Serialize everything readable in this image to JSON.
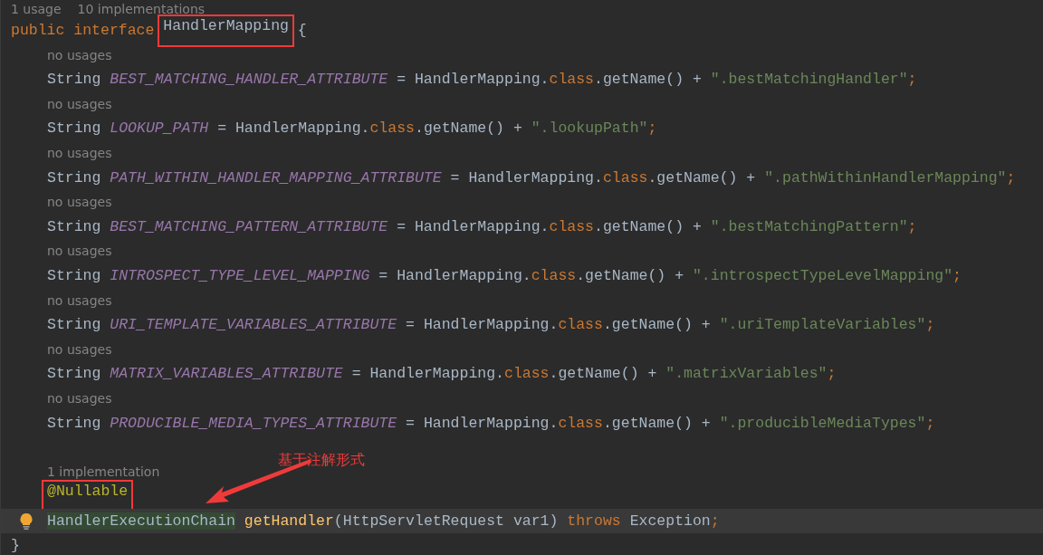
{
  "usage_hints": [
    "1 usage",
    "10 implementations"
  ],
  "declaration": [
    {
      "kind": "keyword",
      "text": "public interface ",
      "boxed": false
    },
    {
      "kind": "plain",
      "text": "HandlerMapping",
      "boxed": true
    },
    {
      "kind": "plain",
      "text": " {",
      "boxed": false
    }
  ],
  "fields": [
    {
      "hint": "no usages",
      "tokens": [
        {
          "kind": "plain",
          "text": "String "
        },
        {
          "kind": "constant",
          "text": "BEST_MATCHING_HANDLER_ATTRIBUTE"
        },
        {
          "kind": "plain",
          "text": " = HandlerMapping."
        },
        {
          "kind": "keyword",
          "text": "class"
        },
        {
          "kind": "plain",
          "text": ".getName() + "
        },
        {
          "kind": "string",
          "text": "\".bestMatchingHandler\""
        },
        {
          "kind": "keyword",
          "text": ";"
        }
      ]
    },
    {
      "hint": "no usages",
      "tokens": [
        {
          "kind": "plain",
          "text": "String "
        },
        {
          "kind": "constant",
          "text": "LOOKUP_PATH"
        },
        {
          "kind": "plain",
          "text": " = HandlerMapping."
        },
        {
          "kind": "keyword",
          "text": "class"
        },
        {
          "kind": "plain",
          "text": ".getName() + "
        },
        {
          "kind": "string",
          "text": "\".lookupPath\""
        },
        {
          "kind": "keyword",
          "text": ";"
        }
      ]
    },
    {
      "hint": "no usages",
      "tokens": [
        {
          "kind": "plain",
          "text": "String "
        },
        {
          "kind": "constant",
          "text": "PATH_WITHIN_HANDLER_MAPPING_ATTRIBUTE"
        },
        {
          "kind": "plain",
          "text": " = HandlerMapping."
        },
        {
          "kind": "keyword",
          "text": "class"
        },
        {
          "kind": "plain",
          "text": ".getName() + "
        },
        {
          "kind": "string",
          "text": "\".pathWithinHandlerMapping\""
        },
        {
          "kind": "keyword",
          "text": ";"
        }
      ]
    },
    {
      "hint": "no usages",
      "tokens": [
        {
          "kind": "plain",
          "text": "String "
        },
        {
          "kind": "constant",
          "text": "BEST_MATCHING_PATTERN_ATTRIBUTE"
        },
        {
          "kind": "plain",
          "text": " = HandlerMapping."
        },
        {
          "kind": "keyword",
          "text": "class"
        },
        {
          "kind": "plain",
          "text": ".getName() + "
        },
        {
          "kind": "string",
          "text": "\".bestMatchingPattern\""
        },
        {
          "kind": "keyword",
          "text": ";"
        }
      ]
    },
    {
      "hint": "no usages",
      "tokens": [
        {
          "kind": "plain",
          "text": "String "
        },
        {
          "kind": "constant",
          "text": "INTROSPECT_TYPE_LEVEL_MAPPING"
        },
        {
          "kind": "plain",
          "text": " = HandlerMapping."
        },
        {
          "kind": "keyword",
          "text": "class"
        },
        {
          "kind": "plain",
          "text": ".getName() + "
        },
        {
          "kind": "string",
          "text": "\".introspectTypeLevelMapping\""
        },
        {
          "kind": "keyword",
          "text": ";"
        }
      ]
    },
    {
      "hint": "no usages",
      "tokens": [
        {
          "kind": "plain",
          "text": "String "
        },
        {
          "kind": "constant",
          "text": "URI_TEMPLATE_VARIABLES_ATTRIBUTE"
        },
        {
          "kind": "plain",
          "text": " = HandlerMapping."
        },
        {
          "kind": "keyword",
          "text": "class"
        },
        {
          "kind": "plain",
          "text": ".getName() + "
        },
        {
          "kind": "string",
          "text": "\".uriTemplateVariables\""
        },
        {
          "kind": "keyword",
          "text": ";"
        }
      ]
    },
    {
      "hint": "no usages",
      "tokens": [
        {
          "kind": "plain",
          "text": "String "
        },
        {
          "kind": "constant",
          "text": "MATRIX_VARIABLES_ATTRIBUTE"
        },
        {
          "kind": "plain",
          "text": " = HandlerMapping."
        },
        {
          "kind": "keyword",
          "text": "class"
        },
        {
          "kind": "plain",
          "text": ".getName() + "
        },
        {
          "kind": "string",
          "text": "\".matrixVariables\""
        },
        {
          "kind": "keyword",
          "text": ";"
        }
      ]
    },
    {
      "hint": "no usages",
      "tokens": [
        {
          "kind": "plain",
          "text": "String "
        },
        {
          "kind": "constant",
          "text": "PRODUCIBLE_MEDIA_TYPES_ATTRIBUTE"
        },
        {
          "kind": "plain",
          "text": " = HandlerMapping."
        },
        {
          "kind": "keyword",
          "text": "class"
        },
        {
          "kind": "plain",
          "text": ".getName() + "
        },
        {
          "kind": "string",
          "text": "\".producibleMediaTypes\""
        },
        {
          "kind": "keyword",
          "text": ";"
        }
      ]
    }
  ],
  "method": {
    "hint": "1 implementation",
    "annotation": {
      "text": "@Nullable",
      "boxed": true
    },
    "current_line": true,
    "return_type": {
      "text": "HandlerExecutionChain",
      "highlighted": true
    },
    "tokens": [
      {
        "kind": "method",
        "text": " getHandler"
      },
      {
        "kind": "plain",
        "text": "(HttpServletRequest var1) "
      },
      {
        "kind": "keyword",
        "text": "throws "
      },
      {
        "kind": "plain",
        "text": "Exception"
      },
      {
        "kind": "keyword",
        "text": ";"
      }
    ]
  },
  "closing": "}",
  "callout": {
    "text": "基于注解形式"
  }
}
